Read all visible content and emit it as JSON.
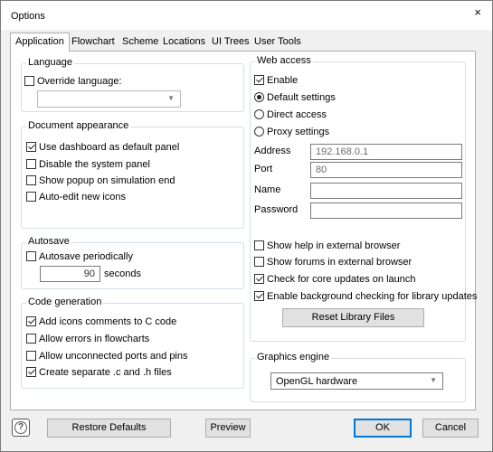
{
  "window": {
    "title": "Options",
    "close_glyph": "×"
  },
  "tabs": [
    {
      "label": "Application",
      "active": true
    },
    {
      "label": "Flowchart"
    },
    {
      "label": "Scheme"
    },
    {
      "label": "Locations"
    },
    {
      "label": "UI Trees"
    },
    {
      "label": "User Tools"
    }
  ],
  "language": {
    "title": "Language",
    "override_label": "Override language:",
    "override_checked": false,
    "selected": ""
  },
  "document_appearance": {
    "title": "Document appearance",
    "items": [
      {
        "label": "Use dashboard as default panel",
        "checked": true
      },
      {
        "label": "Disable the system panel",
        "checked": false
      },
      {
        "label": "Show popup on simulation end",
        "checked": false
      },
      {
        "label": "Auto-edit new icons",
        "checked": false
      }
    ]
  },
  "autosave": {
    "title": "Autosave",
    "periodic_label": "Autosave periodically",
    "periodic_checked": false,
    "interval_value": "90",
    "interval_unit": "seconds"
  },
  "code_generation": {
    "title": "Code generation",
    "items": [
      {
        "label": "Add icons comments to C code",
        "checked": true
      },
      {
        "label": "Allow errors in flowcharts",
        "checked": false
      },
      {
        "label": "Allow unconnected ports and pins",
        "checked": false
      },
      {
        "label": "Create separate .c and .h files",
        "checked": true
      }
    ]
  },
  "web_access": {
    "title": "Web access",
    "enable_label": "Enable",
    "enable_checked": true,
    "radios": [
      {
        "label": "Default settings",
        "checked": true
      },
      {
        "label": "Direct access",
        "checked": false
      },
      {
        "label": "Proxy settings",
        "checked": false
      }
    ],
    "fields": {
      "address_label": "Address",
      "address_value": "192.168.0.1",
      "port_label": "Port",
      "port_value": "80",
      "name_label": "Name",
      "name_value": "",
      "password_label": "Password",
      "password_value": ""
    },
    "options": [
      {
        "label": "Show help in external browser",
        "checked": false
      },
      {
        "label": "Show forums in external browser",
        "checked": false
      },
      {
        "label": "Check for core updates on launch",
        "checked": true
      },
      {
        "label": "Enable background checking for library updates",
        "checked": true
      }
    ],
    "reset_button": "Reset Library Files"
  },
  "graphics_engine": {
    "title": "Graphics engine",
    "selected": "OpenGL hardware"
  },
  "footer": {
    "help_glyph": "?",
    "restore_defaults": "Restore Defaults",
    "preview": "Preview",
    "ok": "OK",
    "cancel": "Cancel"
  },
  "icons": {
    "dropdown_arrow": "▼"
  }
}
